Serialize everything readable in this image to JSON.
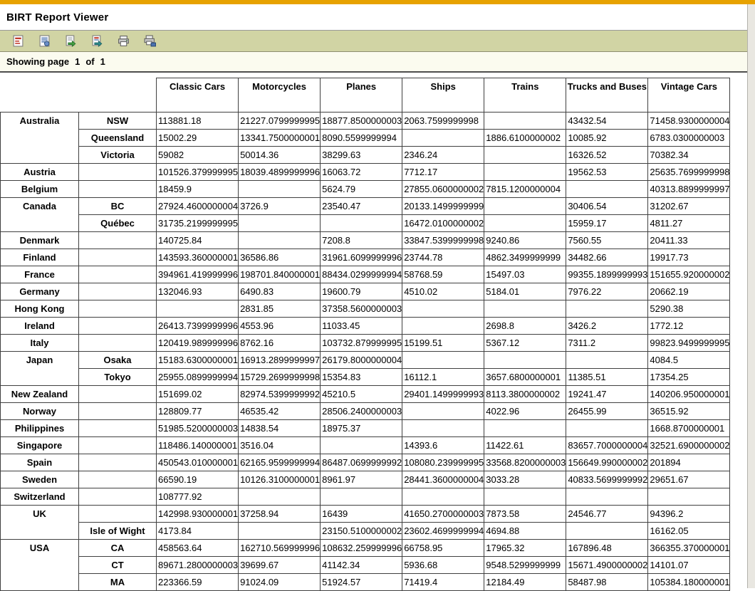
{
  "app": {
    "title": "BIRT Report Viewer",
    "accent_color": "#E7A200",
    "toolbar_color": "#D1D4A4"
  },
  "toolbar": {
    "icons": [
      "toc-icon",
      "run-report-icon",
      "export-data-icon",
      "export-report-icon",
      "print-icon",
      "print-server-icon"
    ]
  },
  "status": {
    "label": "Showing page",
    "current_page": "1",
    "of_label": "of",
    "total_pages": "1"
  },
  "table": {
    "column_headers": [
      "Classic Cars",
      "Motorcycles",
      "Planes",
      "Ships",
      "Trains",
      "Trucks and Buses",
      "Vintage Cars"
    ],
    "groups": [
      {
        "country": "Australia",
        "rows": [
          {
            "state": "NSW",
            "values": [
              "113881.18",
              "21227.0799999995",
              "18877.8500000003",
              "2063.7599999998",
              "",
              "43432.54",
              "71458.9300000004"
            ]
          },
          {
            "state": "Queensland",
            "values": [
              "15002.29",
              "13341.7500000001",
              "8090.5599999994",
              "",
              "1886.6100000002",
              "10085.92",
              "6783.0300000003"
            ]
          },
          {
            "state": "Victoria",
            "values": [
              "59082",
              "50014.36",
              "38299.63",
              "2346.24",
              "",
              "16326.52",
              "70382.34"
            ]
          }
        ]
      },
      {
        "country": "Austria",
        "rows": [
          {
            "state": "",
            "values": [
              "101526.379999995",
              "18039.4899999996",
              "16063.72",
              "7712.17",
              "",
              "19562.53",
              "25635.7699999998"
            ]
          }
        ]
      },
      {
        "country": "Belgium",
        "rows": [
          {
            "state": "",
            "values": [
              "18459.9",
              "",
              "5624.79",
              "27855.0600000002",
              "7815.1200000004",
              "",
              "40313.8899999997"
            ]
          }
        ]
      },
      {
        "country": "Canada",
        "rows": [
          {
            "state": "BC",
            "values": [
              "27924.4600000004",
              "3726.9",
              "23540.47",
              "20133.1499999999",
              "",
              "30406.54",
              "31202.67"
            ]
          },
          {
            "state": "Québec",
            "values": [
              "31735.2199999995",
              "",
              "",
              "16472.0100000002",
              "",
              "15959.17",
              "4811.27"
            ]
          }
        ]
      },
      {
        "country": "Denmark",
        "rows": [
          {
            "state": "",
            "values": [
              "140725.84",
              "",
              "7208.8",
              "33847.5399999998",
              "9240.86",
              "7560.55",
              "20411.33"
            ]
          }
        ]
      },
      {
        "country": "Finland",
        "rows": [
          {
            "state": "",
            "values": [
              "143593.360000001",
              "36586.86",
              "31961.6099999996",
              "23744.78",
              "4862.3499999999",
              "34482.66",
              "19917.73"
            ]
          }
        ]
      },
      {
        "country": "France",
        "rows": [
          {
            "state": "",
            "values": [
              "394961.419999996",
              "198701.840000001",
              "88434.0299999994",
              "58768.59",
              "15497.03",
              "99355.1899999993",
              "151655.920000002"
            ]
          }
        ]
      },
      {
        "country": "Germany",
        "rows": [
          {
            "state": "",
            "values": [
              "132046.93",
              "6490.83",
              "19600.79",
              "4510.02",
              "5184.01",
              "7976.22",
              "20662.19"
            ]
          }
        ]
      },
      {
        "country": "Hong Kong",
        "rows": [
          {
            "state": "",
            "values": [
              "",
              "2831.85",
              "37358.5600000003",
              "",
              "",
              "",
              "5290.38"
            ]
          }
        ]
      },
      {
        "country": "Ireland",
        "rows": [
          {
            "state": "",
            "values": [
              "26413.7399999996",
              "4553.96",
              "11033.45",
              "",
              "2698.8",
              "3426.2",
              "1772.12"
            ]
          }
        ]
      },
      {
        "country": "Italy",
        "rows": [
          {
            "state": "",
            "values": [
              "120419.989999996",
              "8762.16",
              "103732.879999995",
              "15199.51",
              "5367.12",
              "7311.2",
              "99823.9499999995"
            ]
          }
        ]
      },
      {
        "country": "Japan",
        "rows": [
          {
            "state": "Osaka",
            "values": [
              "15183.6300000001",
              "16913.2899999997",
              "26179.8000000004",
              "",
              "",
              "",
              "4084.5"
            ]
          },
          {
            "state": "Tokyo",
            "values": [
              "25955.0899999994",
              "15729.2699999998",
              "15354.83",
              "16112.1",
              "3657.6800000001",
              "11385.51",
              "17354.25"
            ]
          }
        ]
      },
      {
        "country": "New Zealand",
        "rows": [
          {
            "state": "",
            "values": [
              "151699.02",
              "82974.5399999992",
              "45210.5",
              "29401.1499999993",
              "8113.3800000002",
              "19241.47",
              "140206.950000001"
            ]
          }
        ]
      },
      {
        "country": "Norway",
        "rows": [
          {
            "state": "",
            "values": [
              "128809.77",
              "46535.42",
              "28506.2400000003",
              "",
              "4022.96",
              "26455.99",
              "36515.92"
            ]
          }
        ]
      },
      {
        "country": "Philippines",
        "rows": [
          {
            "state": "",
            "values": [
              "51985.5200000003",
              "14838.54",
              "18975.37",
              "",
              "",
              "",
              "1668.8700000001"
            ]
          }
        ]
      },
      {
        "country": "Singapore",
        "rows": [
          {
            "state": "",
            "values": [
              "118486.140000001",
              "3516.04",
              "",
              "14393.6",
              "11422.61",
              "83657.7000000004",
              "32521.6900000002"
            ]
          }
        ]
      },
      {
        "country": "Spain",
        "rows": [
          {
            "state": "",
            "values": [
              "450543.010000001",
              "62165.9599999994",
              "86487.0699999992",
              "108080.239999995",
              "33568.8200000003",
              "156649.990000002",
              "201894"
            ]
          }
        ]
      },
      {
        "country": "Sweden",
        "rows": [
          {
            "state": "",
            "values": [
              "66590.19",
              "10126.3100000001",
              "8961.97",
              "28441.3600000004",
              "3033.28",
              "40833.5699999992",
              "29651.67"
            ]
          }
        ]
      },
      {
        "country": "Switzerland",
        "rows": [
          {
            "state": "",
            "values": [
              "108777.92",
              "",
              "",
              "",
              "",
              "",
              ""
            ]
          }
        ]
      },
      {
        "country": "UK",
        "rows": [
          {
            "state": "",
            "values": [
              "142998.930000001",
              "37258.94",
              "16439",
              "41650.2700000003",
              "7873.58",
              "24546.77",
              "94396.2"
            ]
          },
          {
            "state": "Isle of Wight",
            "values": [
              "4173.84",
              "",
              "23150.5100000002",
              "23602.4699999994",
              "4694.88",
              "",
              "16162.05"
            ]
          }
        ]
      },
      {
        "country": "USA",
        "rows": [
          {
            "state": "CA",
            "values": [
              "458563.64",
              "162710.569999996",
              "108632.259999996",
              "66758.95",
              "17965.32",
              "167896.48",
              "366355.370000001"
            ]
          },
          {
            "state": "CT",
            "values": [
              "89671.2800000003",
              "39699.67",
              "41142.34",
              "5936.68",
              "9548.5299999999",
              "15671.4900000002",
              "14101.07"
            ]
          },
          {
            "state": "MA",
            "values": [
              "223366.59",
              "91024.09",
              "51924.57",
              "71419.4",
              "12184.49",
              "58487.98",
              "105384.180000001"
            ]
          }
        ]
      }
    ]
  }
}
